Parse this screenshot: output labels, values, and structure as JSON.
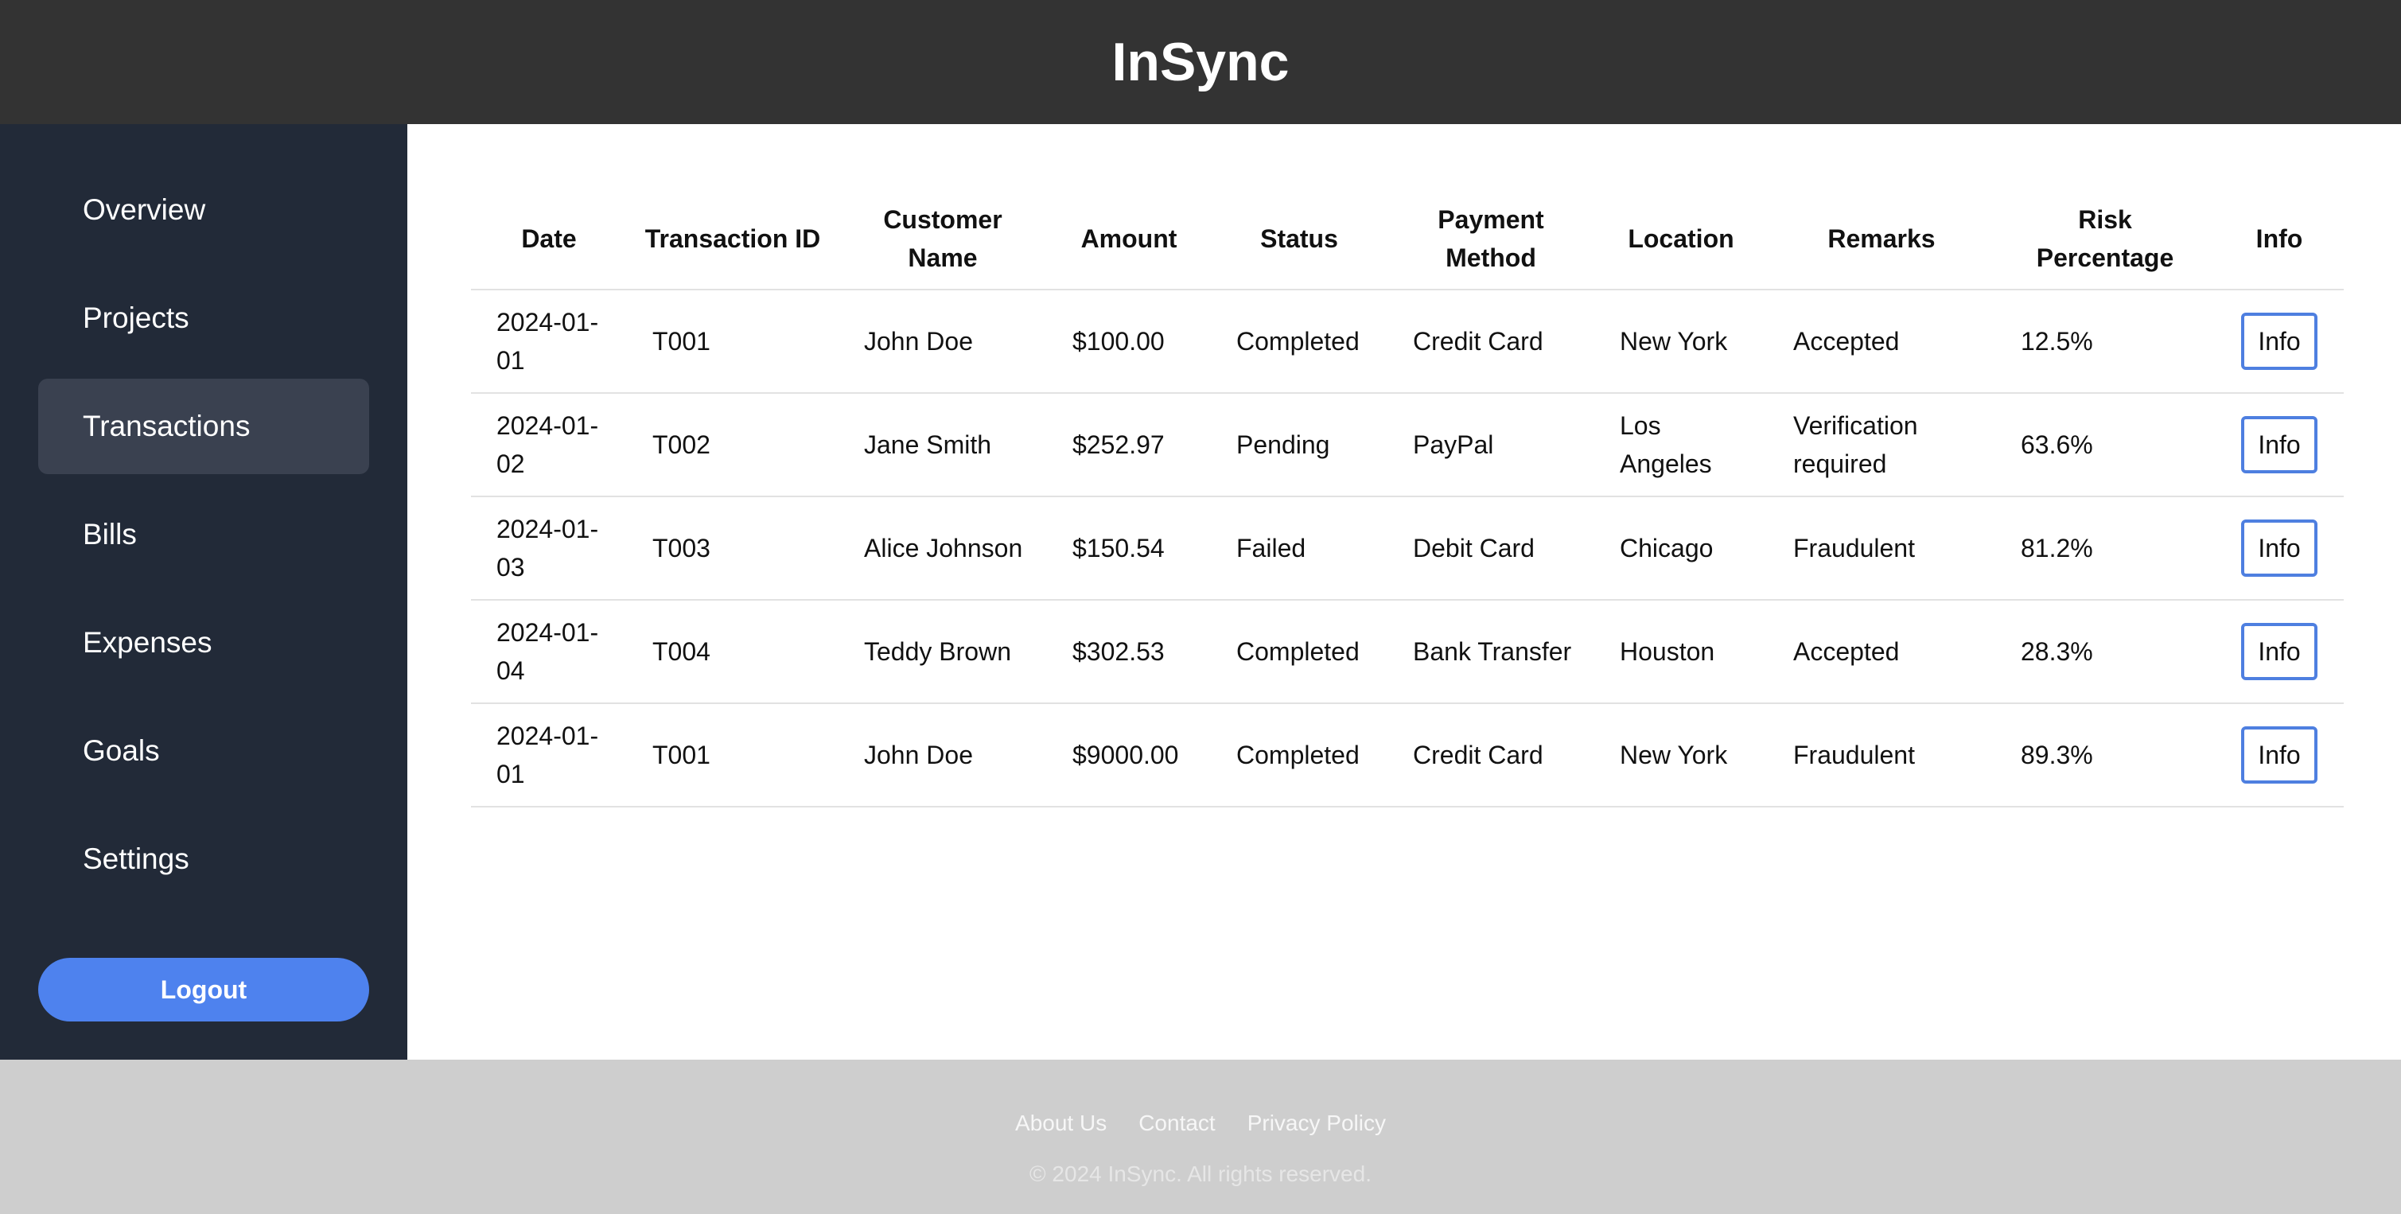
{
  "app": {
    "title": "InSync"
  },
  "sidebar": {
    "items": [
      {
        "label": "Overview"
      },
      {
        "label": "Projects"
      },
      {
        "label": "Transactions"
      },
      {
        "label": "Bills"
      },
      {
        "label": "Expenses"
      },
      {
        "label": "Goals"
      },
      {
        "label": "Settings"
      }
    ],
    "active": "Transactions",
    "logout_label": "Logout"
  },
  "table": {
    "headers": [
      "Date",
      "Transaction ID",
      "Customer Name",
      "Amount",
      "Status",
      "Payment Method",
      "Location",
      "Remarks",
      "Risk Percentage",
      "Info"
    ],
    "rows": [
      {
        "date": "2024-01-01",
        "id": "T001",
        "customer": "John Doe",
        "amount": "$100.00",
        "status": "Completed",
        "method": "Credit Card",
        "location": "New York",
        "remarks": "Accepted",
        "risk": "12.5%",
        "info": "Info"
      },
      {
        "date": "2024-01-02",
        "id": "T002",
        "customer": "Jane Smith",
        "amount": "$252.97",
        "status": "Pending",
        "method": "PayPal",
        "location": "Los Angeles",
        "remarks": "Verification required",
        "risk": "63.6%",
        "info": "Info"
      },
      {
        "date": "2024-01-03",
        "id": "T003",
        "customer": "Alice Johnson",
        "amount": "$150.54",
        "status": "Failed",
        "method": "Debit Card",
        "location": "Chicago",
        "remarks": "Fraudulent",
        "risk": "81.2%",
        "info": "Info"
      },
      {
        "date": "2024-01-04",
        "id": "T004",
        "customer": "Teddy Brown",
        "amount": "$302.53",
        "status": "Completed",
        "method": "Bank Transfer",
        "location": "Houston",
        "remarks": "Accepted",
        "risk": "28.3%",
        "info": "Info"
      },
      {
        "date": "2024-01-01",
        "id": "T001",
        "customer": "John Doe",
        "amount": "$9000.00",
        "status": "Completed",
        "method": "Credit Card",
        "location": "New York",
        "remarks": "Fraudulent",
        "risk": "89.3%",
        "info": "Info"
      }
    ]
  },
  "footer": {
    "links": [
      "About Us",
      "Contact",
      "Privacy Policy"
    ],
    "copyright": "© 2024 InSync. All rights reserved."
  },
  "colors": {
    "header_bg": "#333333",
    "sidebar_bg": "#222a38",
    "sidebar_active_bg": "#3a4150",
    "accent": "#4e82ee",
    "footer_bg": "#cecece"
  }
}
